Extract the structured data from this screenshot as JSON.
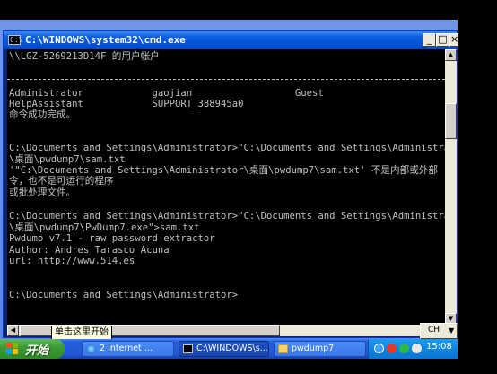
{
  "window": {
    "title": "C:\\WINDOWS\\system32\\cmd.exe",
    "icon_text": "C:\\"
  },
  "titlebar_buttons": {
    "minimize": "_",
    "maximize": "□",
    "close": "×"
  },
  "console_lines": [
    "\\\\LGZ-5269213D14F 的用户帐户",
    "",
    "",
    "Administrator            gaojian                  Guest",
    "HelpAssistant            SUPPORT_388945a0",
    "命令成功完成。",
    "",
    "",
    "C:\\Documents and Settings\\Administrator>\"C:\\Documents and Settings\\Administra",
    "\\桌面\\pwdump7\\sam.txt",
    "'\"C:\\Documents and Settings\\Administrator\\桌面\\pwdump7\\sam.txt' 不是内部或外部",
    "令，也不是可运行的程序",
    "或批处理文件。",
    "",
    "C:\\Documents and Settings\\Administrator>\"C:\\Documents and Settings\\Administra",
    "\\桌面\\pwdump7\\PwDump7.exe\">sam.txt",
    "Pwdump v7.1 - raw password extractor",
    "Author: Andres Tarasco Acuna",
    "url: http://www.514.es",
    "",
    "",
    "C:\\Documents and Settings\\Administrator>"
  ],
  "tooltip": "单击这里开始",
  "ime": {
    "label": "CH"
  },
  "taskbar": {
    "start_label": "开始",
    "tasks": [
      {
        "label": "2 Internet ...",
        "icon": "ie-icon"
      },
      {
        "label": "C:\\WINDOWS\\s...",
        "icon": "cmd-icon"
      },
      {
        "label": "pwdump7",
        "icon": "folder-icon"
      }
    ],
    "clock": "15:08"
  },
  "colors": {
    "console_text": "#c0c0c0",
    "console_bg": "#000000",
    "titlebar": "#0b5fe0",
    "taskbar": "#245edb",
    "start_button": "#3d9b35",
    "tray": "#0f84e0"
  }
}
